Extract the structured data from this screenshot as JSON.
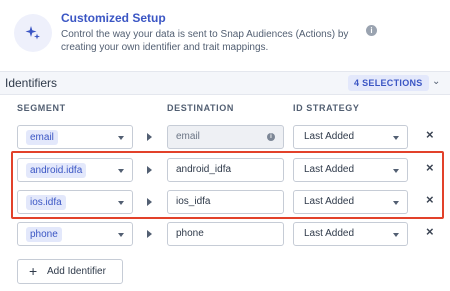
{
  "setup": {
    "title": "Customized Setup",
    "description": "Control the way your data is sent to Snap Audiences (Actions) by creating your own identifier and trait mappings.",
    "icon": "sparkle-icon"
  },
  "identifiers": {
    "title": "Identifiers",
    "selections_badge": "4 SELECTIONS",
    "columns": {
      "segment": "SEGMENT",
      "destination": "DESTINATION",
      "id_strategy": "ID STRATEGY"
    },
    "rows": [
      {
        "segment": "email",
        "destination": "email",
        "destination_readonly": true,
        "strategy": "Last Added"
      },
      {
        "segment": "android.idfa",
        "destination": "android_idfa",
        "destination_readonly": false,
        "strategy": "Last Added"
      },
      {
        "segment": "ios.idfa",
        "destination": "ios_idfa",
        "destination_readonly": false,
        "strategy": "Last Added"
      },
      {
        "segment": "phone",
        "destination": "phone",
        "destination_readonly": false,
        "strategy": "Last Added"
      }
    ],
    "add_button": "Add Identifier"
  },
  "colors": {
    "accent": "#3b56c4",
    "highlight": "#e2412a",
    "chip_bg": "#e3e8fb"
  }
}
